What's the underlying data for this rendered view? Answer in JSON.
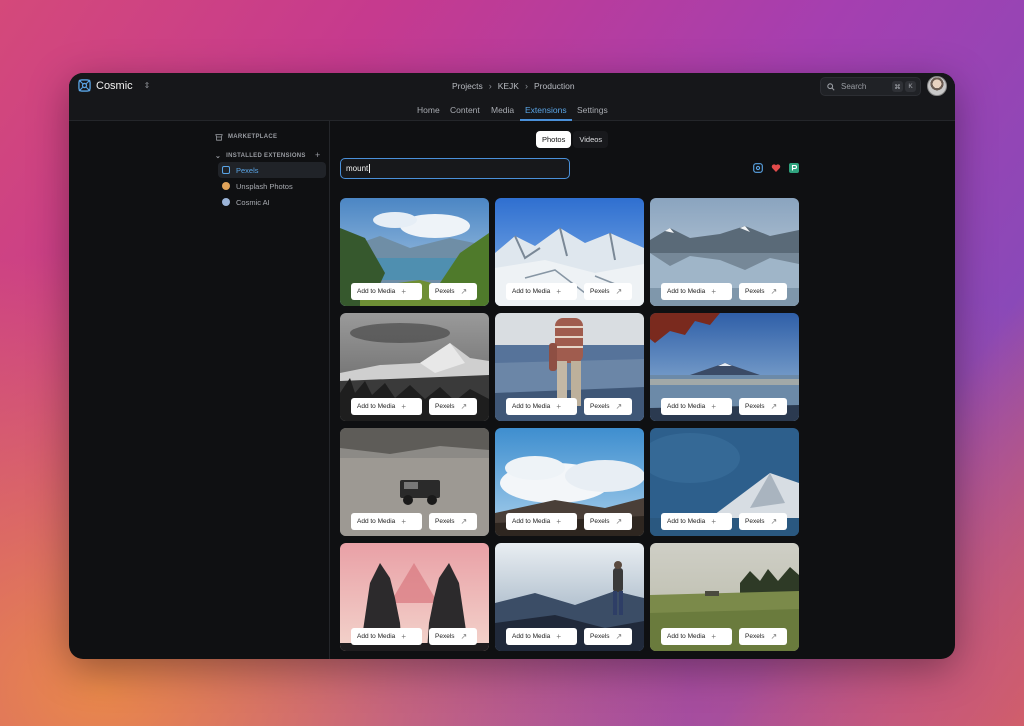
{
  "app": {
    "name": "Cosmic"
  },
  "breadcrumb": [
    "Projects",
    "KEJK",
    "Production"
  ],
  "search": {
    "placeholder": "Search",
    "keys": [
      "⌘",
      "K"
    ]
  },
  "nav": {
    "tabs": [
      {
        "label": "Home"
      },
      {
        "label": "Content"
      },
      {
        "label": "Media"
      },
      {
        "label": "Extensions",
        "active": true
      },
      {
        "label": "Settings"
      }
    ]
  },
  "sidebar": {
    "marketplace_label": "MARKETPLACE",
    "installed_label": "INSTALLED EXTENSIONS",
    "items": [
      {
        "label": "Pexels",
        "active": true,
        "color": "#5aa5e6"
      },
      {
        "label": "Unsplash Photos",
        "color": "#e0a35a"
      },
      {
        "label": "Cosmic AI",
        "color": "#9bb4d8"
      }
    ]
  },
  "media_type": {
    "options": [
      "Photos",
      "Videos"
    ],
    "selected": "Photos"
  },
  "query": "mount",
  "card_labels": {
    "add": "Add to Media",
    "source": "Pexels"
  },
  "photos": [
    {
      "subject": "lake-valley-mountains"
    },
    {
      "subject": "snowy-peaks"
    },
    {
      "subject": "mountain-lake-reflection"
    },
    {
      "subject": "black-white-mountains"
    },
    {
      "subject": "hiker-on-peak"
    },
    {
      "subject": "mount-fuji-lake"
    },
    {
      "subject": "jeep-in-desert"
    },
    {
      "subject": "clouds-over-mountains"
    },
    {
      "subject": "aerial-volcano"
    },
    {
      "subject": "temple-gate-sunset"
    },
    {
      "subject": "person-on-cliff"
    },
    {
      "subject": "green-meadow-forest"
    }
  ],
  "colors": {
    "accent": "#4a90d9",
    "window_bg": "#0f1012"
  }
}
